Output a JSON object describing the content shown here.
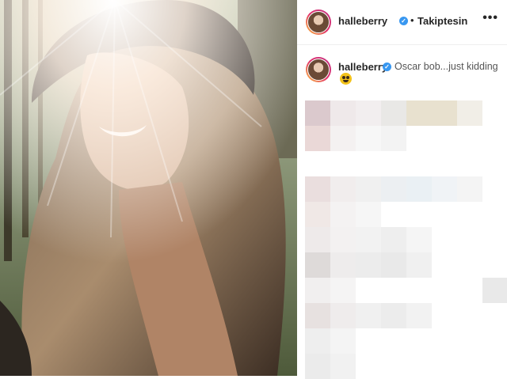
{
  "post": {
    "photo_alt": "Selfie photo",
    "header": {
      "username": "halleberry",
      "verified_icon": "verified-badge-icon",
      "separator": "•",
      "follow_label": "Takiptesin",
      "more_label": "•••"
    },
    "caption": {
      "username": "halleberry",
      "text": "Oscar bob...just kidding",
      "emoji": "grinning-emoji-icon"
    },
    "colors": {
      "verified": "#3897f0",
      "avatar_ring_start": "#f9c23c",
      "avatar_ring_end": "#c13584"
    }
  }
}
